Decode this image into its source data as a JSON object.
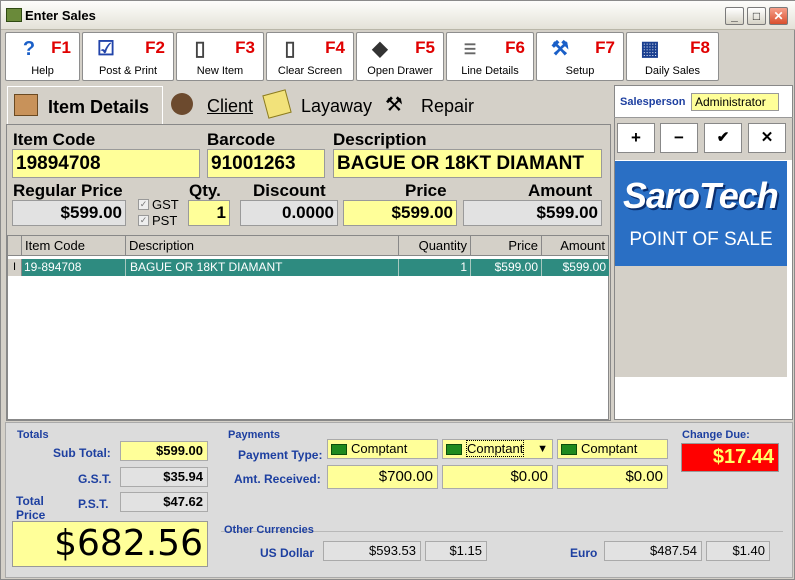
{
  "window": {
    "title": "Enter Sales"
  },
  "toolbar": [
    {
      "key": "F1",
      "label": "Help",
      "icon": "help-icon"
    },
    {
      "key": "F2",
      "label": "Post & Print",
      "icon": "post-print-icon"
    },
    {
      "key": "F3",
      "label": "New Item",
      "icon": "new-document-icon"
    },
    {
      "key": "F4",
      "label": "Clear Screen",
      "icon": "clear-document-icon"
    },
    {
      "key": "F5",
      "label": "Open Drawer",
      "icon": "cash-drawer-icon"
    },
    {
      "key": "F6",
      "label": "Line Details",
      "icon": "line-details-icon"
    },
    {
      "key": "F7",
      "label": "Setup",
      "icon": "wrench-icon"
    },
    {
      "key": "F8",
      "label": "Daily Sales",
      "icon": "calendar-icon"
    }
  ],
  "tabs": [
    {
      "label": "Item Details",
      "active": true,
      "icon": "box-icon"
    },
    {
      "label": "Client",
      "active": false,
      "icon": "person-icon"
    },
    {
      "label": "Layaway",
      "active": false,
      "icon": "notepad-icon"
    },
    {
      "label": "Repair",
      "active": false,
      "icon": "hammer-icon"
    }
  ],
  "item": {
    "code_label": "Item Code",
    "code": "19894708",
    "barcode_label": "Barcode",
    "barcode": "91001263",
    "description_label": "Description",
    "description": "BAGUE OR 18KT DIAMANT",
    "regular_price_label": "Regular Price",
    "regular_price": "$599.00",
    "gst_label": "GST",
    "pst_label": "PST",
    "gst_checked": true,
    "pst_checked": true,
    "qty_label": "Qty.",
    "qty": "1",
    "discount_label": "Discount",
    "discount": "0.0000",
    "price_label": "Price",
    "price": "$599.00",
    "amount_label": "Amount",
    "amount": "$599.00"
  },
  "grid": {
    "columns": [
      "Item Code",
      "Description",
      "Quantity",
      "Price",
      "Amount"
    ],
    "rows": [
      {
        "code": "19-894708",
        "description": "BAGUE OR 18KT DIAMANT",
        "quantity": "1",
        "price": "$599.00",
        "amount": "$599.00"
      }
    ]
  },
  "salesperson": {
    "label": "Salesperson",
    "value": "Administrator"
  },
  "side_buttons": [
    "+",
    "−",
    "✔",
    "✕"
  ],
  "brand": {
    "name": "SaroTech",
    "tagline": "POINT OF SALE"
  },
  "totals": {
    "heading": "Totals",
    "subtotal_label": "Sub Total:",
    "subtotal": "$599.00",
    "gst_label": "G.S.T.",
    "gst": "$35.94",
    "pst_label": "P.S.T.",
    "pst": "$47.62",
    "total_label_1": "Total",
    "total_label_2": "Price",
    "total": "$682.56"
  },
  "payments": {
    "heading": "Payments",
    "type_label": "Payment Type:",
    "received_label": "Amt. Received:",
    "types": [
      "Comptant",
      "Comptant",
      "Comptant"
    ],
    "amounts": [
      "$700.00",
      "$0.00",
      "$0.00"
    ]
  },
  "change": {
    "label": "Change Due:",
    "value": "$17.44"
  },
  "currencies": {
    "heading": "Other Currencies",
    "usd_label": "US Dollar",
    "usd_amount": "$593.53",
    "usd_rate": "$1.15",
    "euro_label": "Euro",
    "euro_amount": "$487.54",
    "euro_rate": "$1.40"
  },
  "colors": {
    "field_yellow": "#ffff99",
    "grid_row": "#2e8b80",
    "fkey": "#e00000",
    "change_red": "#ff0000",
    "brand_blue": "#2a6fc4"
  }
}
